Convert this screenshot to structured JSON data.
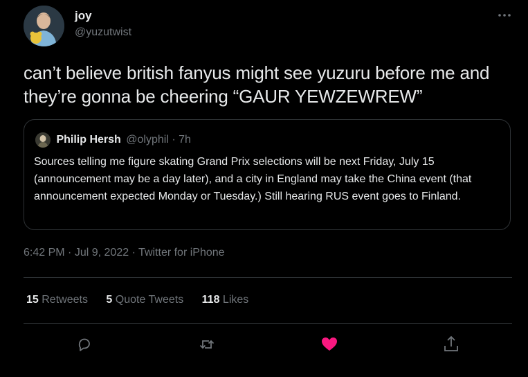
{
  "author": {
    "display_name": "joy",
    "handle": "@yuzutwist"
  },
  "tweet": {
    "text": "can’t believe british fanyus might see yuzuru before me and they’re gonna be cheering “GAUR YEWZEWREW”"
  },
  "quoted_tweet": {
    "display_name": "Philip Hersh",
    "handle": "@olyphil",
    "separator": "·",
    "time": "7h",
    "text": "Sources telling me figure skating Grand Prix selections will be next Friday, July 15 (announcement may be a day later), and a city in England may take the China event (that announcement expected Monday or Tuesday.)  Still hearing RUS event goes to Finland."
  },
  "meta": {
    "time": "6:42 PM",
    "separator": "·",
    "date": "Jul 9, 2022",
    "source": "Twitter for iPhone"
  },
  "stats": {
    "retweets_count": "15",
    "retweets_label": "Retweets",
    "quotes_count": "5",
    "quotes_label": "Quote Tweets",
    "likes_count": "118",
    "likes_label": "Likes"
  },
  "icons": {
    "reply": "reply-icon",
    "retweet": "retweet-icon",
    "like": "heart-icon",
    "share": "share-icon",
    "more": "more-icon"
  },
  "colors": {
    "background": "#000000",
    "text": "#e7e9ea",
    "muted": "#71767b",
    "border": "#2f3336",
    "like_active": "#f91880"
  }
}
